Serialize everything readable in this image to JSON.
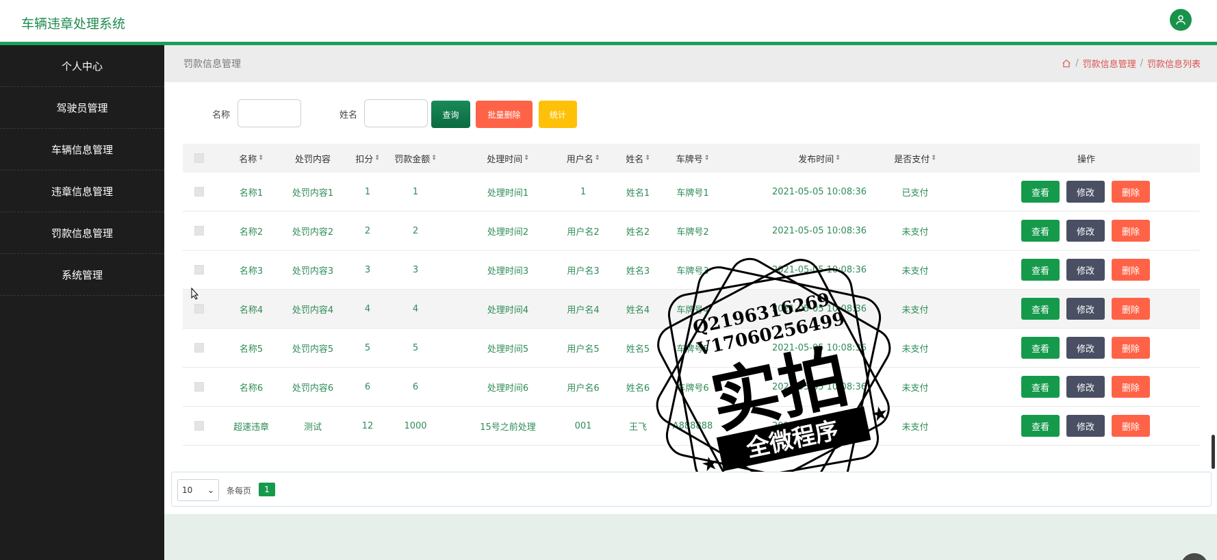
{
  "header": {
    "app_title": "车辆违章处理系统",
    "avatar_icon": "user-icon"
  },
  "sidebar": {
    "items": [
      {
        "label": "个人中心"
      },
      {
        "label": "驾驶员管理"
      },
      {
        "label": "车辆信息管理"
      },
      {
        "label": "违章信息管理"
      },
      {
        "label": "罚款信息管理"
      },
      {
        "label": "系统管理"
      }
    ]
  },
  "breadcrumb": {
    "page_title": "罚款信息管理",
    "home_icon": "home-icon",
    "crumbs": [
      "罚款信息管理",
      "罚款信息列表"
    ],
    "separator": "/"
  },
  "search": {
    "name_label": "名称",
    "person_label": "姓名",
    "query_button": "查询",
    "batch_delete_button": "批量删除",
    "stats_button": "统计"
  },
  "table": {
    "headers": [
      "名称",
      "处罚内容",
      "扣分",
      "罚款金额",
      "处理时间",
      "用户名",
      "姓名",
      "车牌号",
      "发布时间",
      "是否支付",
      "操作"
    ],
    "sort_glyph": "⇕",
    "rows": [
      {
        "name": "名称1",
        "content": "处罚内容1",
        "points": "1",
        "fine": "1",
        "handle_time": "处理时间1",
        "username": "1",
        "person": "姓名1",
        "plate": "车牌号1",
        "publish": "2021-05-05 10:08:36",
        "paid": "已支付"
      },
      {
        "name": "名称2",
        "content": "处罚内容2",
        "points": "2",
        "fine": "2",
        "handle_time": "处理时间2",
        "username": "用户名2",
        "person": "姓名2",
        "plate": "车牌号2",
        "publish": "2021-05-05 10:08:36",
        "paid": "未支付"
      },
      {
        "name": "名称3",
        "content": "处罚内容3",
        "points": "3",
        "fine": "3",
        "handle_time": "处理时间3",
        "username": "用户名3",
        "person": "姓名3",
        "plate": "车牌号3",
        "publish": "2021-05-05 10:08:36",
        "paid": "未支付"
      },
      {
        "name": "名称4",
        "content": "处罚内容4",
        "points": "4",
        "fine": "4",
        "handle_time": "处理时间4",
        "username": "用户名4",
        "person": "姓名4",
        "plate": "车牌号4",
        "publish": "2021-05-05 10:08:36",
        "paid": "未支付"
      },
      {
        "name": "名称5",
        "content": "处罚内容5",
        "points": "5",
        "fine": "5",
        "handle_time": "处理时间5",
        "username": "用户名5",
        "person": "姓名5",
        "plate": "车牌号5",
        "publish": "2021-05-05 10:08:36",
        "paid": "未支付"
      },
      {
        "name": "名称6",
        "content": "处罚内容6",
        "points": "6",
        "fine": "6",
        "handle_time": "处理时间6",
        "username": "用户名6",
        "person": "姓名6",
        "plate": "车牌号6",
        "publish": "2021-05-05 10:08:36",
        "paid": "未支付"
      },
      {
        "name": "超速违章",
        "content": "测试",
        "points": "12",
        "fine": "1000",
        "handle_time": "15号之前处理",
        "username": "001",
        "person": "王飞",
        "plate": "A888888",
        "publish": "2021-05-05 09:10:39",
        "paid": "未支付"
      }
    ],
    "actions": {
      "view": "查看",
      "edit": "修改",
      "delete": "删除"
    }
  },
  "pagination": {
    "page_size": "10",
    "per_page_label": "条每页",
    "current_page": "1"
  },
  "watermark": {
    "line1": "Q2196316269",
    "line2": "V17060256499",
    "big_text": "实拍",
    "banner": "全微程序"
  },
  "colors": {
    "accent_green": "#159a4c",
    "danger": "#ff6347",
    "warning": "#ffc107",
    "sidebar_bg": "#1d1d1d"
  }
}
